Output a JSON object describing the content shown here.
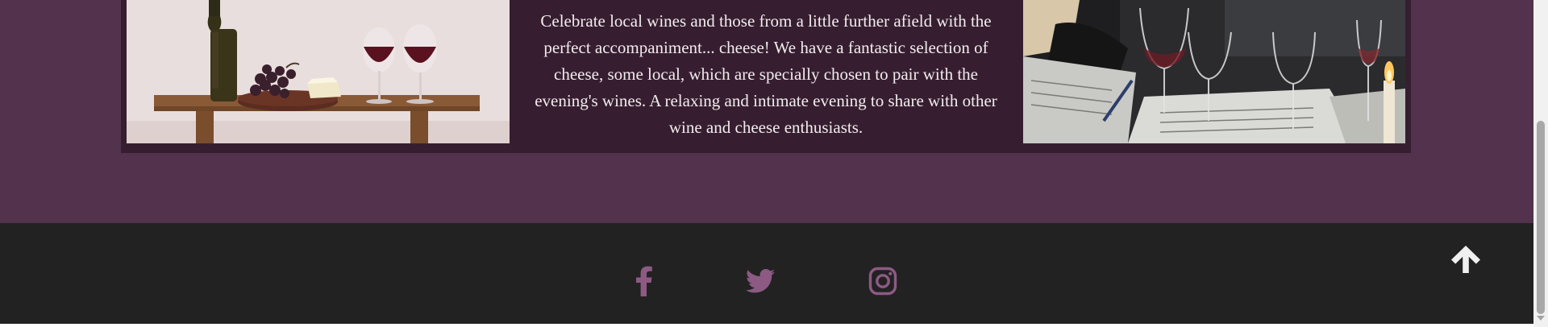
{
  "event_card": {
    "description": "Celebrate local wines and those from a little further afield with the perfect accompaniment... cheese! We have a fantastic selection of cheese, some local, which are specially chosen to pair with the evening's wines. A relaxing and intimate evening to share with other wine and cheese enthusiasts."
  },
  "colors": {
    "page_background": "#52324d",
    "card_background": "#361e30",
    "footer_background": "#222222",
    "social_icon": "#8d5a84",
    "text": "#f2ecef"
  },
  "footer": {
    "social_links": [
      {
        "icon": "facebook-icon"
      },
      {
        "icon": "twitter-icon"
      },
      {
        "icon": "instagram-icon"
      }
    ],
    "back_to_top_icon": "arrow-up-icon"
  }
}
